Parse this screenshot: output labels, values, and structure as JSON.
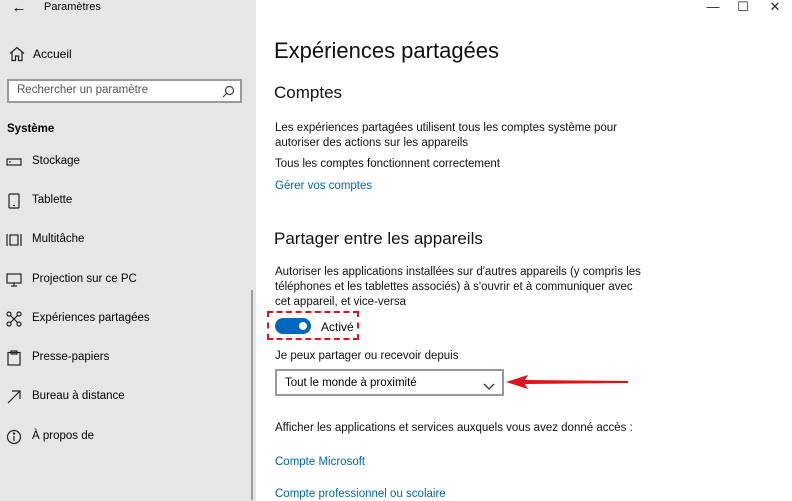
{
  "window": {
    "app_title": "Paramètres",
    "back_symbol": "←",
    "minimize_symbol": "—",
    "maximize_symbol": "☐",
    "close_symbol": "✕"
  },
  "sidebar": {
    "home_label": "Accueil",
    "home_icon": "home-icon",
    "search_placeholder": "Rechercher un paramètre",
    "section_title": "Système",
    "items": [
      {
        "label": "Stockage",
        "icon": "storage-icon"
      },
      {
        "label": "Tablette",
        "icon": "tablet-icon"
      },
      {
        "label": "Multitâche",
        "icon": "multitask-icon"
      },
      {
        "label": "Projection sur ce PC",
        "icon": "projection-icon"
      },
      {
        "label": "Expériences partagées",
        "icon": "shared-experiences-icon"
      },
      {
        "label": "Presse-papiers",
        "icon": "clipboard-icon"
      },
      {
        "label": "Bureau à distance",
        "icon": "remote-desktop-icon"
      },
      {
        "label": "À propos de",
        "icon": "info-icon"
      }
    ]
  },
  "main": {
    "page_title": "Expériences partagées",
    "accounts": {
      "heading": "Comptes",
      "description_line1": "Les expériences partagées utilisent tous les comptes système pour",
      "description_line2": "autoriser des actions sur les appareils",
      "status": "Tous les comptes fonctionnent correctement",
      "manage_link": "Gérer vos comptes"
    },
    "share_across": {
      "heading": "Partager entre les appareils",
      "description_line1": "Autoriser les applications installées sur d'autres appareils (y compris les",
      "description_line2": "téléphones et les tablettes associés) à s'ouvrir et à communiquer avec",
      "description_line3": "cet appareil, et vice-versa",
      "toggle_state": "Activé",
      "toggle_on": true,
      "dropdown_label": "Je peux partager ou recevoir depuis",
      "dropdown_value": "Tout le monde à proximité",
      "apps_label": "Afficher les applications et services auxquels vous avez donné accès :",
      "link_microsoft": "Compte Microsoft",
      "link_work": "Compte professionnel ou scolaire"
    }
  },
  "colors": {
    "sidebar_bg": "#e6e6e6",
    "accent": "#0067c0",
    "link": "#0067b8",
    "annotation": "#e0131b"
  }
}
